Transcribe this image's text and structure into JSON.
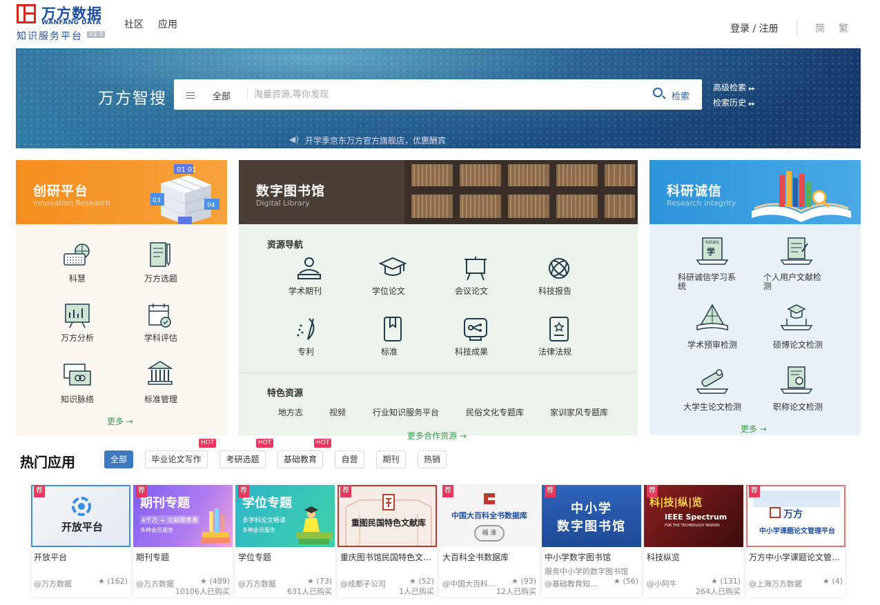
{
  "header": {
    "logo_cn": "万方数据",
    "logo_en": "WANFANG DATA",
    "logo_sub": "知识服务平台",
    "logo_version": "V2.0",
    "nav": [
      "社区",
      "应用"
    ],
    "login": "登录 / 注册",
    "lang_simplified": "简",
    "lang_traditional": "繁"
  },
  "search": {
    "brand": "万方智搜",
    "scope": "全部",
    "placeholder": "海量资源,等你发现",
    "button": "检索",
    "advanced": "高级检索",
    "history": "检索历史",
    "notice": "开学季京东万方官方旗舰店，优惠酬宾"
  },
  "innovation": {
    "title": "创研平台",
    "subtitle": "innovation Research",
    "items": [
      "科慧",
      "万方选题",
      "万方分析",
      "学科评估",
      "知识脉络",
      "标准管理"
    ],
    "more": "更多"
  },
  "library": {
    "title": "数字图书馆",
    "subtitle": "Digital Library",
    "nav_title": "资源导航",
    "resources": [
      "学术期刊",
      "学位论文",
      "会议论文",
      "科技报告",
      "专利",
      "标准",
      "科技成果",
      "法律法规"
    ],
    "special_title": "特色资源",
    "special": [
      "地方志",
      "视频",
      "行业知识服务平台",
      "民俗文化专题库",
      "家训家风专题库"
    ],
    "more": "更多合作资源"
  },
  "integrity": {
    "title": "科研诚信",
    "subtitle": "Research integrity",
    "items": [
      "科研诚信学习系统",
      "个人用户文献检测",
      "学术预审检测",
      "硕博论文检测",
      "大学生论文检测",
      "职称论文检测"
    ],
    "more": "更多"
  },
  "hot": {
    "title": "热门应用",
    "filters": [
      {
        "label": "全部",
        "hot": ""
      },
      {
        "label": "毕业论文写作",
        "hot": "HOT"
      },
      {
        "label": "考研选题",
        "hot": "HOT"
      },
      {
        "label": "基础教育",
        "hot": "HOT"
      },
      {
        "label": "自营",
        "hot": ""
      },
      {
        "label": "期刊",
        "hot": ""
      },
      {
        "label": "热销",
        "hot": ""
      }
    ],
    "rec_tag": "荐",
    "cards": [
      {
        "img_title": "开放平台",
        "name": "开放平台",
        "desc": "",
        "author": "@万方数据",
        "rating": "(162)",
        "buyers": ""
      },
      {
        "img_title": "期刊专题",
        "img_sub": "4千万 + 文献随意看",
        "img_sub2": "多种会员服务",
        "name": "期刊专题",
        "desc": "",
        "author": "@万方数据",
        "rating": "(489)",
        "buyers": "10106人已购买"
      },
      {
        "img_title": "学位专题",
        "img_sub": "多学科论文畅读",
        "img_sub2": "多种会员服务",
        "name": "学位专题",
        "desc": "",
        "author": "@万方数据",
        "rating": "(73)",
        "buyers": "631人已购买"
      },
      {
        "img_title": "重图民国特色文献库",
        "name": "重庆图书馆民国特色文献库",
        "desc": "",
        "author": "@成都子公司",
        "rating": "(52)",
        "buyers": "1人已购买"
      },
      {
        "img_title": "中国大百科全书数据库",
        "img_sub": "福 淮",
        "name": "大百科全书数据库",
        "desc": "",
        "author": "@中国大百科全书",
        "rating": "(93)",
        "buyers": "12人已购买"
      },
      {
        "img_title": "中小学",
        "img_title2": "数字图书馆",
        "name": "中小学数字图书馆",
        "desc": "服务中小学的数字图书馆",
        "author": "@基础教育知识服务",
        "rating": "(56)",
        "buyers": ""
      },
      {
        "img_title": "科|技|纵|览",
        "img_sub": "IEEE Spectrum",
        "img_sub2": "FOR THE TECHNOLOGY INSIDER",
        "name": "科技纵览",
        "desc": "",
        "author": "@小阿牛",
        "rating": "(131)",
        "buyers": "264人已购买"
      },
      {
        "img_title": "万方",
        "img_sub": "中小学课题论文管理平台",
        "name": "万方中小学课题论文管理平台",
        "desc": "",
        "author": "@上海万方数据",
        "rating": "(4)",
        "buyers": ""
      }
    ]
  }
}
